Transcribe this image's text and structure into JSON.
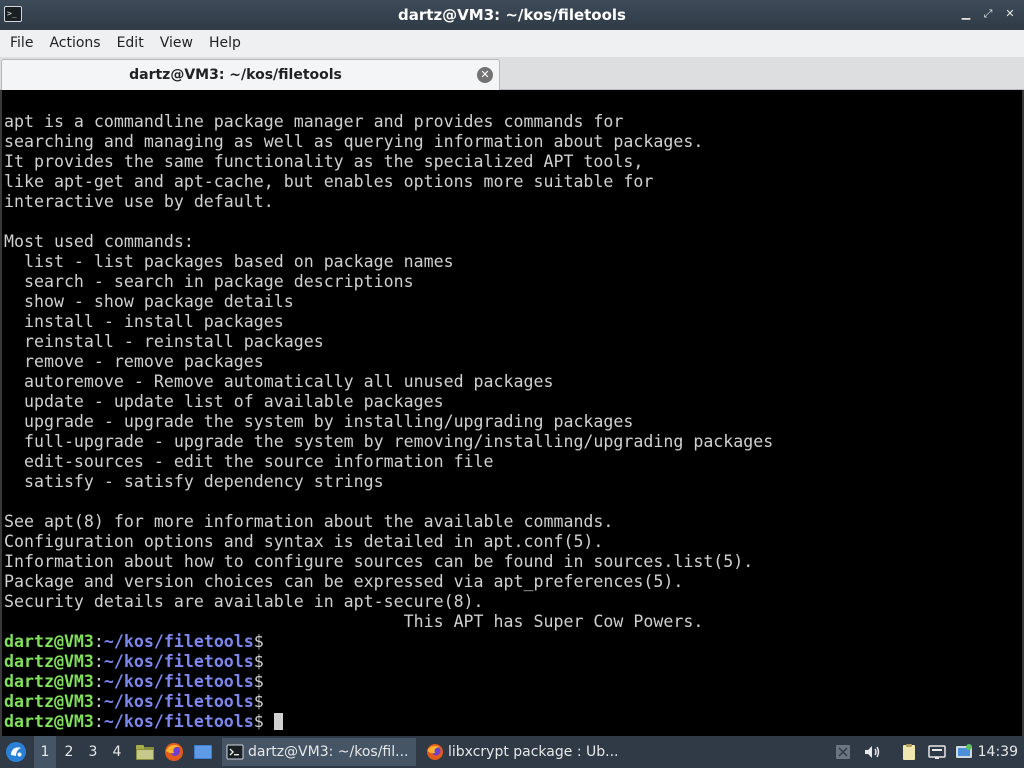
{
  "window": {
    "title": "dartz@VM3: ~/kos/filetools",
    "app_icon_text": ">_"
  },
  "menu": [
    "File",
    "Actions",
    "Edit",
    "View",
    "Help"
  ],
  "tab": {
    "label": "dartz@VM3: ~/kos/filetools"
  },
  "terminal": {
    "output_lines": [
      "apt is a commandline package manager and provides commands for",
      "searching and managing as well as querying information about packages.",
      "It provides the same functionality as the specialized APT tools,",
      "like apt-get and apt-cache, but enables options more suitable for",
      "interactive use by default.",
      "",
      "Most used commands:",
      "  list - list packages based on package names",
      "  search - search in package descriptions",
      "  show - show package details",
      "  install - install packages",
      "  reinstall - reinstall packages",
      "  remove - remove packages",
      "  autoremove - Remove automatically all unused packages",
      "  update - update list of available packages",
      "  upgrade - upgrade the system by installing/upgrading packages",
      "  full-upgrade - upgrade the system by removing/installing/upgrading packages",
      "  edit-sources - edit the source information file",
      "  satisfy - satisfy dependency strings",
      "",
      "See apt(8) for more information about the available commands.",
      "Configuration options and syntax is detailed in apt.conf(5).",
      "Information about how to configure sources can be found in sources.list(5).",
      "Package and version choices can be expressed via apt_preferences(5).",
      "Security details are available in apt-secure(8).",
      "                                        This APT has Super Cow Powers."
    ],
    "prompt": {
      "user": "dartz@VM3",
      "colon": ":",
      "path": "~/kos/filetools",
      "dollar": "$"
    },
    "prompt_count": 5
  },
  "taskbar": {
    "workspaces": [
      "1",
      "2",
      "3",
      "4"
    ],
    "active_workspace": 0,
    "tasks": [
      {
        "label": "dartz@VM3: ~/kos/fil...",
        "icon": "terminal-icon"
      },
      {
        "label": "libxcrypt package : Ub...",
        "icon": "firefox-icon"
      }
    ],
    "clock": "14:39"
  },
  "colors": {
    "prompt_user": "#7fe05a",
    "prompt_path": "#7d87f0",
    "terminal_bg": "#000000",
    "terminal_fg": "#d0d0d0",
    "taskbar_bg": "#2f3a46"
  }
}
